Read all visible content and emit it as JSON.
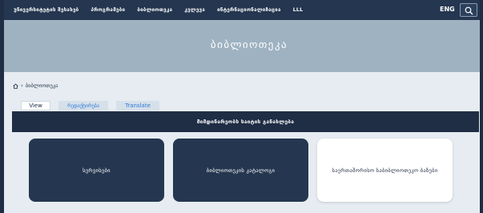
{
  "nav": {
    "items": [
      "უნივერსიტეტის შესახებ",
      "პროგრამები",
      "ბიბლიოთეკა",
      "კვლევა",
      "ინტერნაციონალიზაცია",
      "LLL"
    ],
    "lang": "ENG",
    "search_icon": "search-icon"
  },
  "hero": {
    "title": "ბიბლიოთეკა"
  },
  "breadcrumb": {
    "home_icon": "home-icon",
    "separator": "›",
    "current": "ბიბლიოთეკა"
  },
  "tabs": [
    "View",
    "რედაქტირება",
    "Translate"
  ],
  "banner": {
    "text": "მიმდინარეობს საიტის განახლება"
  },
  "cards": [
    {
      "label": "სერვისები"
    },
    {
      "label": "ბიბლიოთეკის კატალოგი"
    },
    {
      "label": "საერთაშორისო საბიბლიოთეკო ბაზები"
    }
  ],
  "colors": {
    "nav_bg": "#243650",
    "hero_bg": "#9eb2c2",
    "page_bg": "#e6ecf1",
    "card_dark": "#253750",
    "link_blue": "#2f7ad6"
  }
}
